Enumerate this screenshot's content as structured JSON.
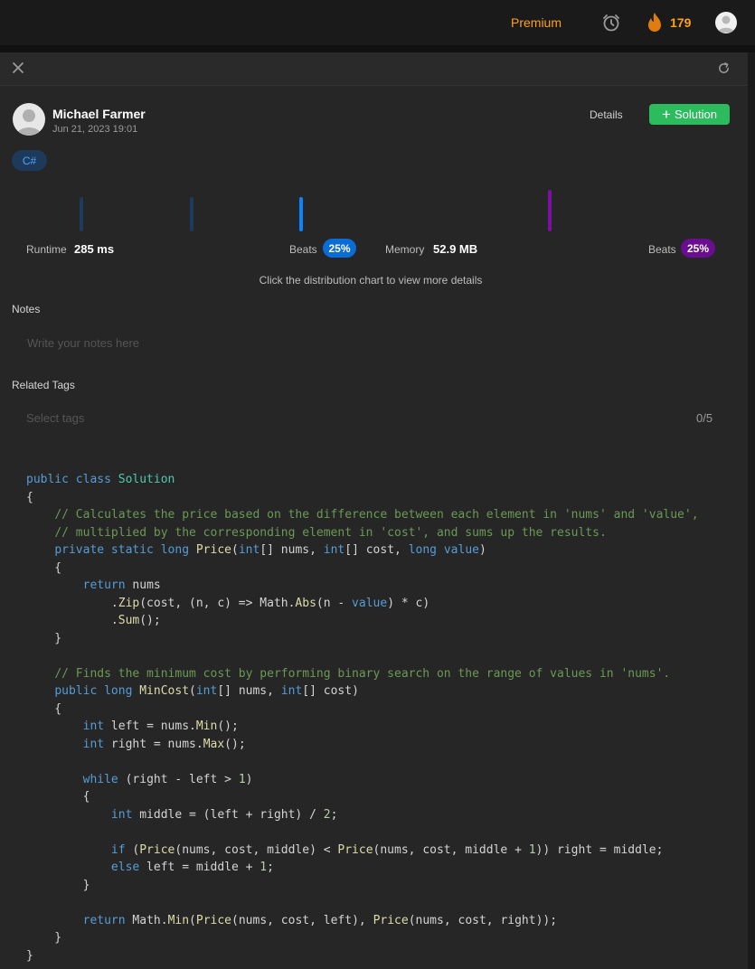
{
  "topbar": {
    "premium": "Premium",
    "streak": "179"
  },
  "author": {
    "name": "Michael Farmer",
    "date": "Jun 21, 2023 19:01"
  },
  "actions": {
    "details": "Details",
    "solution": "Solution"
  },
  "language": "C#",
  "stats": {
    "runtime_label": "Runtime",
    "runtime_value": "285 ms",
    "runtime_beats_label": "Beats",
    "runtime_beats": "25%",
    "memory_label": "Memory",
    "memory_value": "52.9 MB",
    "memory_beats_label": "Beats",
    "memory_beats": "25%",
    "hint": "Click the distribution chart to view more details"
  },
  "notes": {
    "label": "Notes",
    "placeholder": "Write your notes here"
  },
  "tags": {
    "label": "Related Tags",
    "placeholder": "Select tags",
    "count": "0/5"
  },
  "colors": {
    "accent_orange": "#ffa116",
    "success_green": "#2cbb5d",
    "runtime_blue": "#0a84ff",
    "memory_purple": "#7a0fa0"
  }
}
